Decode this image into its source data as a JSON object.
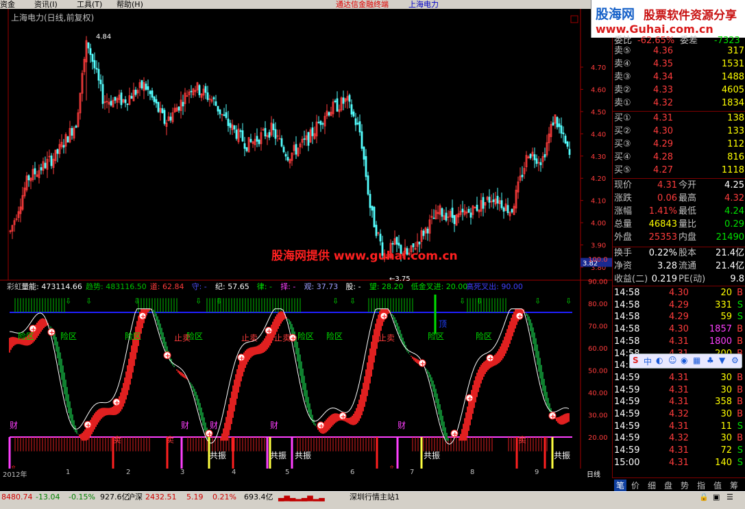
{
  "menu": {
    "items": [
      "资金",
      "资讯(I)",
      "工具(T)",
      "帮助(H)"
    ],
    "app_title": "通达信金融终端",
    "stock_title": "上海电力"
  },
  "logo": {
    "line1a": "股海网",
    "line1b": "股票软件资源分享",
    "line2": "www.Guhai.com.cn"
  },
  "main_chart": {
    "title": "上海电力(日线,前复权)",
    "price_axis": [
      "4.70",
      "4.60",
      "4.50",
      "4.40",
      "4.30",
      "4.20",
      "4.10",
      "4.00",
      "3.90",
      "3.80"
    ],
    "high_label": "4.84",
    "low_label": "3.75",
    "current_price_tag": "3.82",
    "watermark": "股海网提供  www.guhai.com.cn",
    "colors": {
      "up": "#ff3c3c",
      "down": "#54ffff",
      "bg": "#000000"
    }
  },
  "indicator": {
    "header": [
      {
        "text": "彩虹",
        "color": "#c0c0c0"
      },
      {
        "text": "量能: 473114.66",
        "color": "#ffffff"
      },
      {
        "text": "趋势: 483116.50",
        "color": "#00c000"
      },
      {
        "text": "道: 62.84",
        "color": "#ff3c3c"
      },
      {
        "text": "守: -",
        "color": "#5050ff"
      },
      {
        "text": "纪: 57.65",
        "color": "#ffffff"
      },
      {
        "text": "律: -",
        "color": "#00e000"
      },
      {
        "text": "择: -",
        "color": "#ff40ff"
      },
      {
        "text": "观: 37.73",
        "color": "#a0a0ff"
      },
      {
        "text": "股: -",
        "color": "#ffffff"
      },
      {
        "text": "望: 28.20",
        "color": "#00e000"
      },
      {
        "text": "低金叉进: 20.00",
        "color": "#00e000"
      },
      {
        "text": "高死叉出: 90.00",
        "color": "#4040ff"
      }
    ],
    "axis": [
      "100.0",
      "90.00",
      "80.00",
      "70.00",
      "60.00",
      "50.00",
      "40.00",
      "30.00",
      "20.00"
    ],
    "labels_risk": "险区",
    "labels_stop": "止卖",
    "labels_top": "顶",
    "labels_wealth": "财",
    "labels_sell": "卖",
    "labels_resonance": "共振"
  },
  "date_axis": {
    "labels": [
      "2012年",
      "1",
      "2",
      "3",
      "4",
      "5",
      "6",
      "7",
      "8",
      "9"
    ],
    "period": "日线"
  },
  "order_book": {
    "top_partial": {
      "label1": "委比",
      "value1": "-62.65%",
      "label2": "委差",
      "value2": "-7323"
    },
    "sell": [
      {
        "label": "卖⑤",
        "price": "4.36",
        "vol": "317"
      },
      {
        "label": "卖④",
        "price": "4.35",
        "vol": "1531"
      },
      {
        "label": "卖③",
        "price": "4.34",
        "vol": "1488"
      },
      {
        "label": "卖②",
        "price": "4.33",
        "vol": "4605"
      },
      {
        "label": "卖①",
        "price": "4.32",
        "vol": "1834"
      }
    ],
    "buy": [
      {
        "label": "买①",
        "price": "4.31",
        "vol": "138"
      },
      {
        "label": "买②",
        "price": "4.30",
        "vol": "133"
      },
      {
        "label": "买③",
        "price": "4.29",
        "vol": "112"
      },
      {
        "label": "买④",
        "price": "4.28",
        "vol": "816"
      },
      {
        "label": "买⑤",
        "price": "4.27",
        "vol": "1118"
      }
    ]
  },
  "quote": [
    {
      "l1": "现价",
      "v1": "4.31",
      "c1": "red",
      "l2": "今开",
      "v2": "4.25",
      "c2": "wht"
    },
    {
      "l1": "涨跌",
      "v1": "0.06",
      "c1": "red",
      "l2": "最高",
      "v2": "4.32",
      "c2": "red"
    },
    {
      "l1": "涨幅",
      "v1": "1.41%",
      "c1": "red",
      "l2": "最低",
      "v2": "4.24",
      "c2": "grn"
    },
    {
      "l1": "总量",
      "v1": "46843",
      "c1": "yel",
      "l2": "量比",
      "v2": "0.29",
      "c2": "grn"
    },
    {
      "l1": "外盘",
      "v1": "25353",
      "c1": "red",
      "l2": "内盘",
      "v2": "21490",
      "c2": "grn"
    },
    {
      "l1": "换手",
      "v1": "0.22%",
      "c1": "wht",
      "l2": "股本",
      "v2": "21.4亿",
      "c2": "wht"
    },
    {
      "l1": "净资",
      "v1": "3.28",
      "c1": "wht",
      "l2": "流通",
      "v2": "21.4亿",
      "c2": "wht"
    },
    {
      "l1": "收益(二)",
      "v1": "0.219",
      "c1": "wht",
      "l2": "PE(动)",
      "v2": "9.8",
      "c2": "wht"
    }
  ],
  "ticks": [
    {
      "t": "14:58",
      "p": "4.30",
      "v": "20",
      "s": "B"
    },
    {
      "t": "14:58",
      "p": "4.29",
      "v": "331",
      "s": "S"
    },
    {
      "t": "14:58",
      "p": "4.29",
      "v": "59",
      "s": "S"
    },
    {
      "t": "14:58",
      "p": "4.30",
      "v": "1857",
      "s": "B"
    },
    {
      "t": "14:58",
      "p": "4.31",
      "v": "1800",
      "s": "B"
    },
    {
      "t": "14:58",
      "p": "4.31",
      "v": "200",
      "s": "B"
    },
    {
      "t": "14:58",
      "p": "4.31",
      "v": "20",
      "s": "B"
    },
    {
      "t": "14:59",
      "p": "4.31",
      "v": "30",
      "s": "B"
    },
    {
      "t": "14:59",
      "p": "4.31",
      "v": "30",
      "s": "B"
    },
    {
      "t": "14:59",
      "p": "4.31",
      "v": "358",
      "s": "B"
    },
    {
      "t": "14:59",
      "p": "4.32",
      "v": "30",
      "s": "B"
    },
    {
      "t": "14:59",
      "p": "4.31",
      "v": "11",
      "s": "S"
    },
    {
      "t": "14:59",
      "p": "4.32",
      "v": "30",
      "s": "B"
    },
    {
      "t": "14:59",
      "p": "4.31",
      "v": "72",
      "s": "S"
    },
    {
      "t": "15:00",
      "p": "4.31",
      "v": "140",
      "s": "S"
    }
  ],
  "tabs": [
    "笔",
    "价",
    "细",
    "盘",
    "势",
    "指",
    "值",
    "筹"
  ],
  "ime": {
    "label": "中"
  },
  "status": {
    "sh_index": "8480.74",
    "sh_change": "-13.04",
    "sh_pct": "-0.15%",
    "sh_amount": "927.6亿",
    "sz_name": "沪深",
    "sz_index": "2432.51",
    "sz_change": "5.19",
    "sz_pct": "0.21%",
    "sz_amount": "693.4亿",
    "server": "深圳行情主站1"
  }
}
